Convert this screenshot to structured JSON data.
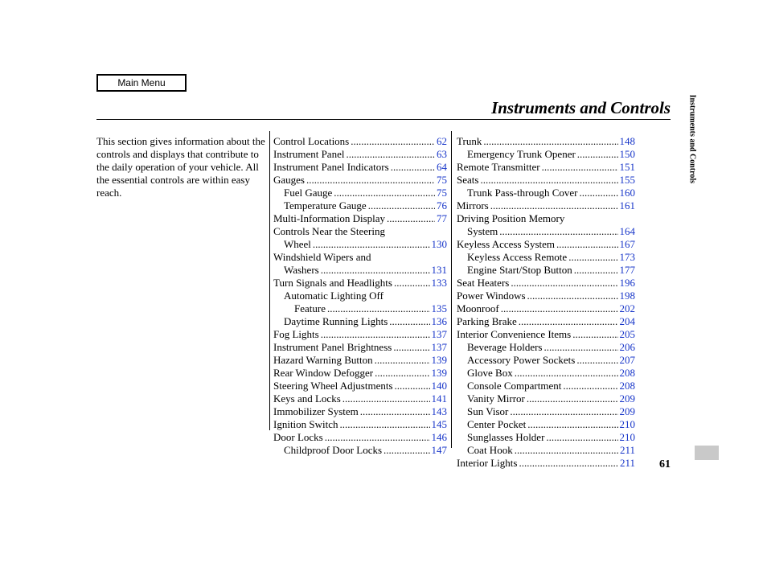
{
  "header": {
    "main_menu_label": "Main Menu",
    "page_title": "Instruments and Controls",
    "side_tab": "Instruments and Controls",
    "page_number": "61"
  },
  "intro": "This section gives information about the controls and displays that contribute to the daily operation of your vehicle. All the essential controls are within easy reach.",
  "toc": {
    "col2": [
      {
        "label": "Control Locations",
        "page": "62",
        "indent": 0
      },
      {
        "label": "Instrument Panel",
        "page": "63",
        "indent": 0
      },
      {
        "label": "Instrument Panel Indicators",
        "page": "64",
        "indent": 0
      },
      {
        "label": "Gauges",
        "page": "75",
        "indent": 0
      },
      {
        "label": "Fuel Gauge",
        "page": "75",
        "indent": 1
      },
      {
        "label": "Temperature Gauge",
        "page": "76",
        "indent": 1
      },
      {
        "label": "Multi-Information Display",
        "page": "77",
        "indent": 0
      },
      {
        "label": "Controls Near the Steering",
        "cont": "Wheel",
        "page": "130",
        "indent": 0,
        "multiline": true
      },
      {
        "label": "Windshield Wipers and",
        "cont": "Washers",
        "page": "131",
        "indent": 0,
        "multiline": true
      },
      {
        "label": "Turn Signals and Headlights",
        "page": "133",
        "indent": 0
      },
      {
        "label": "Automatic Lighting Off",
        "cont": "Feature",
        "page": "135",
        "indent": 1,
        "multiline": true
      },
      {
        "label": "Daytime Running Lights",
        "page": "136",
        "indent": 1
      },
      {
        "label": "Fog Lights",
        "page": "137",
        "indent": 0
      },
      {
        "label": "Instrument Panel Brightness",
        "page": "137",
        "indent": 0
      },
      {
        "label": "Hazard Warning Button",
        "page": "139",
        "indent": 0
      },
      {
        "label": "Rear Window Defogger",
        "page": "139",
        "indent": 0
      },
      {
        "label": "Steering Wheel Adjustments",
        "page": "140",
        "indent": 0
      },
      {
        "label": "Keys and Locks",
        "page": "141",
        "indent": 0
      },
      {
        "label": "Immobilizer System",
        "page": "143",
        "indent": 0
      },
      {
        "label": "Ignition Switch",
        "page": "145",
        "indent": 0
      },
      {
        "label": "Door Locks",
        "page": "146",
        "indent": 0
      },
      {
        "label": "Childproof Door Locks",
        "page": "147",
        "indent": 1
      }
    ],
    "col3": [
      {
        "label": "Trunk",
        "page": "148",
        "indent": 0
      },
      {
        "label": "Emergency Trunk Opener",
        "page": "150",
        "indent": 1
      },
      {
        "label": "Remote Transmitter",
        "page": "151",
        "indent": 0
      },
      {
        "label": "Seats",
        "page": "155",
        "indent": 0
      },
      {
        "label": "Trunk Pass-through Cover",
        "page": "160",
        "indent": 1
      },
      {
        "label": "Mirrors",
        "page": "161",
        "indent": 0
      },
      {
        "label": "Driving Position Memory",
        "cont": "System",
        "page": "164",
        "indent": 0,
        "multiline": true
      },
      {
        "label": "Keyless Access System",
        "page": "167",
        "indent": 0
      },
      {
        "label": "Keyless Access Remote",
        "page": "173",
        "indent": 1
      },
      {
        "label": "Engine Start/Stop Button",
        "page": "177",
        "indent": 1
      },
      {
        "label": "Seat Heaters",
        "page": "196",
        "indent": 0
      },
      {
        "label": "Power Windows",
        "page": "198",
        "indent": 0
      },
      {
        "label": "Moonroof",
        "page": "202",
        "indent": 0
      },
      {
        "label": "Parking Brake",
        "page": "204",
        "indent": 0
      },
      {
        "label": "Interior Convenience Items",
        "page": "205",
        "indent": 0
      },
      {
        "label": "Beverage Holders",
        "page": "206",
        "indent": 1
      },
      {
        "label": "Accessory Power Sockets",
        "page": "207",
        "indent": 1
      },
      {
        "label": "Glove Box",
        "page": "208",
        "indent": 1
      },
      {
        "label": "Console Compartment",
        "page": "208",
        "indent": 1
      },
      {
        "label": "Vanity Mirror",
        "page": "209",
        "indent": 1
      },
      {
        "label": "Sun Visor",
        "page": "209",
        "indent": 1
      },
      {
        "label": "Center Pocket",
        "page": "210",
        "indent": 1
      },
      {
        "label": "Sunglasses Holder",
        "page": "210",
        "indent": 1
      },
      {
        "label": "Coat Hook",
        "page": "211",
        "indent": 1
      },
      {
        "label": "Interior Lights",
        "page": "211",
        "indent": 0
      }
    ]
  }
}
